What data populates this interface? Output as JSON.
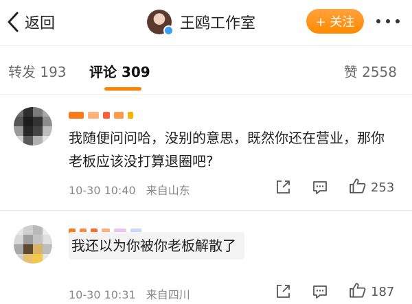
{
  "header": {
    "back_label": "返回",
    "account_name": "王鸥工作室",
    "follow_label": "+ 关注",
    "more_label": "• • •"
  },
  "tabs": [
    {
      "label": "转发 193"
    },
    {
      "label": "评论 309"
    },
    {
      "label": "赞 2558"
    }
  ],
  "comments": [
    {
      "text": "我随便问问哈，没别的意思，既然你还在营业，那你老板应该没打算退圈吧?",
      "time": "10-30 10:40",
      "location": "来自山东",
      "likes": "253"
    },
    {
      "text": "我还以为你被你老板解散了",
      "time": "10-30 10:31",
      "location": "来自四川",
      "likes": "187"
    }
  ],
  "colors": {
    "accent": "#ff8200",
    "follow_button": "#ff9a1f",
    "verified_badge": "#3aa1f2"
  },
  "icons": [
    "back-chevron-icon",
    "verified-badge-icon",
    "share-icon",
    "reply-icon",
    "like-icon"
  ]
}
